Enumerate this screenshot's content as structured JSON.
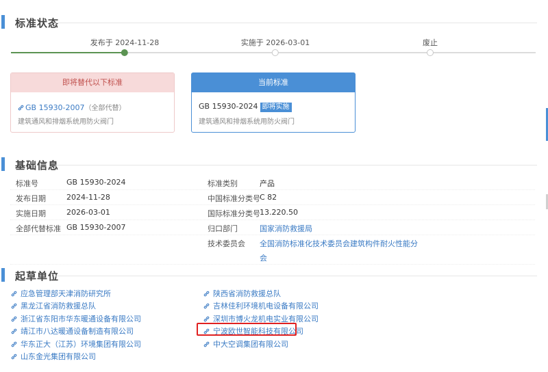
{
  "sections": {
    "status": "标准状态",
    "basic": "基础信息",
    "drafters": "起草单位"
  },
  "timeline": {
    "steps": [
      {
        "label": "发布于 2024-11-28",
        "done": true
      },
      {
        "label": "实施于 2026-03-01",
        "done": false
      },
      {
        "label": "废止",
        "done": false
      }
    ]
  },
  "replaced_card": {
    "header": "即将替代以下标准",
    "code": "GB 15930-2007",
    "note": "（全部代替）",
    "name": "建筑通风和排烟系统用防火阀门"
  },
  "current_card": {
    "header": "当前标准",
    "code": "GB 15930-2024",
    "badge": "即将实施",
    "name": "建筑通风和排烟系统用防火阀门"
  },
  "info": {
    "rows": [
      {
        "k1": "标准号",
        "v1": "GB 15930-2024",
        "k2": "标准类别",
        "v2": "产品"
      },
      {
        "k1": "发布日期",
        "v1": "2024-11-28",
        "k2": "中国标准分类号",
        "v2": "C 82"
      },
      {
        "k1": "实施日期",
        "v1": "2026-03-01",
        "k2": "国际标准分类号",
        "v2": "13.220.50"
      },
      {
        "k1": "全部代替标准",
        "v1": "GB 15930-2007",
        "k2": "归口部门",
        "v2": "国家消防救援局"
      },
      {
        "k1": "",
        "v1": "",
        "k2": "技术委员会",
        "v2": "全国消防标准化技术委员会建筑构件耐火性能分"
      },
      {
        "k1": "",
        "v1": "",
        "k2": "",
        "v2": "会"
      }
    ]
  },
  "drafters": {
    "left": [
      "应急管理部天津消防研究所",
      "黑龙江省消防救援总队",
      "浙江省东阳市华东暖通设备有限公司",
      "靖江市八达暖通设备制造有限公司",
      "华东正大（江苏）环境集团有限公司",
      "山东金光集团有限公司"
    ],
    "right": [
      "陕西省消防救援总队",
      "吉林佳利环境机电设备有限公司",
      "深圳市博火龙机电实业有限公司",
      "宁波欧世智能科技有限公司",
      "中大空调集团有限公司"
    ]
  },
  "colors": {
    "accent": "#4a8fd6",
    "progress": "#5b9352",
    "highlight": "#e02020"
  }
}
